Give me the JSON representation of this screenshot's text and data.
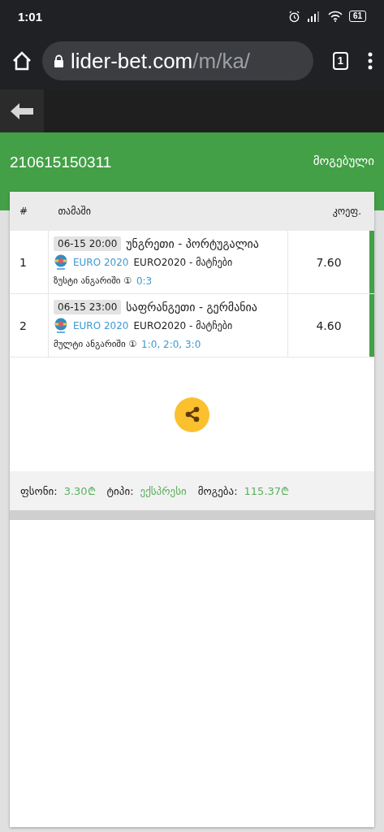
{
  "status_bar": {
    "time": "1:01",
    "battery": "61"
  },
  "browser": {
    "url_host": "lider-bet.com",
    "url_path": "/m/ka/",
    "tab_count": "1"
  },
  "ticket": {
    "id": "210615150311",
    "status": "მოგებული"
  },
  "table": {
    "columns": [
      "#",
      "თამაში",
      "კოეფ."
    ],
    "rows": [
      {
        "number": "1",
        "time": "06-15 20:00",
        "match": "უნგრეთი - პორტუგალია",
        "league": "EURO 2020",
        "tournament": "EURO2020 - მატჩები",
        "market": "ზუსტი ანგარიში ①",
        "pick": "0:3",
        "odds": "7.60",
        "won": true
      },
      {
        "number": "2",
        "time": "06-15 23:00",
        "match": "საფრანგეთი - გერმანია",
        "league": "EURO 2020",
        "tournament": "EURO2020 - მატჩები",
        "market": "მულტი ანგარიში ①",
        "pick": "1:0, 2:0, 3:0",
        "odds": "4.60",
        "won": true
      }
    ]
  },
  "summary": [
    {
      "label": "ფსონი:",
      "value": "3.30₾"
    },
    {
      "label": "ტიპი:",
      "value": "ექსპრესი"
    },
    {
      "label": "მოგება:",
      "value": "115.37₾"
    }
  ]
}
